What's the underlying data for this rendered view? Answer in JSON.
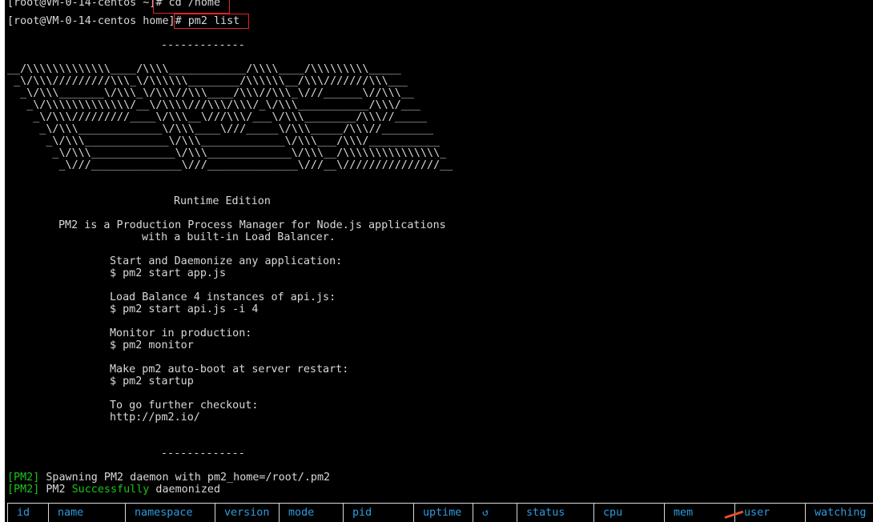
{
  "prompt_lines": [
    {
      "prompt": "[root@VM-0-14-centos ~]",
      "command": "# cd /home"
    },
    {
      "prompt": "[root@VM-0-14-centos home]",
      "command": "# pm2 list"
    }
  ],
  "separator_top": "-------------",
  "logo_ascii": [
    "__/\\\\\\\\\\\\\\\\\\\\\\\\\\____/\\\\\\\\____________/\\\\\\\\____/\\\\\\\\\\\\\\\\\\_____",
    " _\\/\\\\\\/////////\\\\\\_\\/\\\\\\\\\\\\________/\\\\\\\\\\\\__/\\\\\\///////\\\\\\___",
    "  _\\/\\\\\\_______\\/\\\\\\_\\/\\\\\\//\\\\\\____/\\\\\\//\\\\\\_\\///______\\//\\\\\\__",
    "   _\\/\\\\\\\\\\\\\\\\\\\\\\\\\\/__\\/\\\\\\\\///\\\\\\/\\\\\\/_\\/\\\\\\___________/\\\\\\/___",
    "    _\\/\\\\\\/////////____\\/\\\\\\__\\///\\\\\\/___\\/\\\\\\________/\\\\\\//_____",
    "     _\\/\\\\\\_____________\\/\\\\\\____\\///_____\\/\\\\\\_____/\\\\\\//________",
    "      _\\/\\\\\\_____________\\/\\\\\\_____________\\/\\\\\\___/\\\\\\/___________",
    "       _\\/\\\\\\_____________\\/\\\\\\_____________\\/\\\\\\__/\\\\\\\\\\\\\\\\\\\\\\\\\\\\\\_",
    "        _\\///______________\\///______________\\///__\\///////////////__"
  ],
  "edition": "Runtime Edition",
  "description_1": "PM2 is a Production Process Manager for Node.js applications",
  "description_2": "with a built-in Load Balancer.",
  "tips": [
    {
      "label": "Start and Daemonize any application:",
      "cmd": "$ pm2 start app.js"
    },
    {
      "label": "Load Balance 4 instances of api.js:",
      "cmd": "$ pm2 start api.js -i 4"
    },
    {
      "label": "Monitor in production:",
      "cmd": "$ pm2 monitor"
    },
    {
      "label": "Make pm2 auto-boot at server restart:",
      "cmd": "$ pm2 startup"
    },
    {
      "label": "To go further checkout:",
      "cmd": "http://pm2.io/"
    }
  ],
  "separator_bottom": "-------------",
  "daemon_messages": {
    "tag": "[PM2]",
    "spawn_text": " Spawning PM2 daemon with pm2_home=/root/.pm2",
    "success_prefix": " PM2 ",
    "success_word": "Successfully",
    "success_suffix": " daemonized"
  },
  "table_headers": [
    "id",
    "name",
    "namespace",
    "version",
    "mode",
    "pid",
    "uptime",
    "↺",
    "status",
    "cpu",
    "mem",
    "user",
    "watching"
  ],
  "colors": {
    "background": "#000000",
    "text": "#d9d9d9",
    "pm2_tag": "#19c519",
    "table_header": "#2d9be0",
    "highlight_box": "#e02424"
  }
}
